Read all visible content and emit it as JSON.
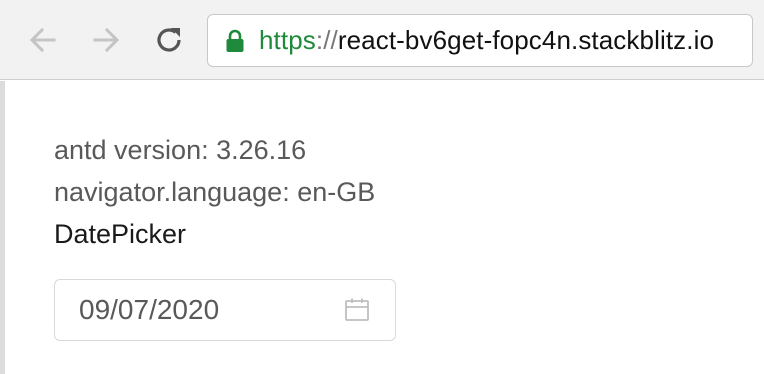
{
  "browser": {
    "back_icon": "arrow-left-icon",
    "forward_icon": "arrow-right-icon",
    "reload_icon": "reload-icon",
    "lock_icon": "lock-icon",
    "url_scheme": "https",
    "url_separator": "://",
    "url_host": "react-bv6get-fopc4n.stackblitz.io"
  },
  "page": {
    "antd_version_line": "antd version: 3.26.16",
    "language_line": "navigator.language: en-GB",
    "component_label": "DatePicker"
  },
  "datepicker": {
    "value": "09/07/2020",
    "icon": "calendar-icon"
  },
  "colors": {
    "secure_green": "#1f8a3b",
    "toolbar_bg": "#f2f2f2",
    "text_secondary": "#595959",
    "border": "#d9d9d9"
  }
}
